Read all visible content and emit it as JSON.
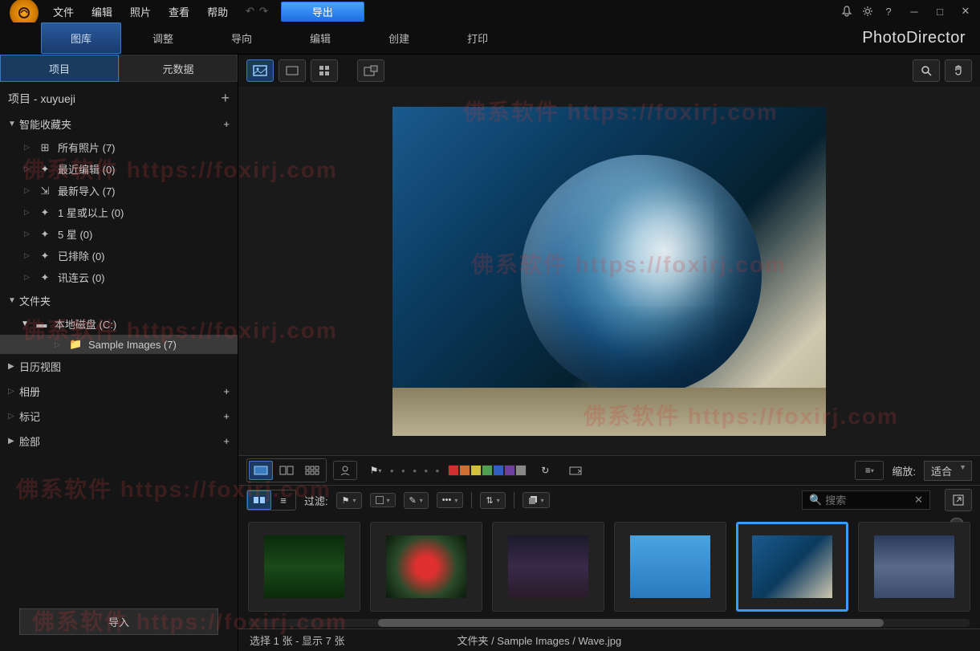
{
  "menu": {
    "file": "文件",
    "edit": "编辑",
    "photo": "照片",
    "view": "查看",
    "help": "帮助",
    "export": "导出"
  },
  "brand": "PhotoDirector",
  "tabs": {
    "library": "图库",
    "adjust": "调整",
    "guided": "导向",
    "edit": "编辑",
    "create": "创建",
    "print": "打印"
  },
  "sidebar": {
    "tabs": {
      "project": "项目",
      "metadata": "元数据"
    },
    "project_header": "项目 - xuyueji",
    "sections": {
      "smart": "智能收藏夹",
      "folders": "文件夹",
      "calendar": "日历视图",
      "albums": "相册",
      "tags": "标记",
      "faces": "脸部"
    },
    "smart_items": [
      {
        "label": "所有照片 (7)"
      },
      {
        "label": "最近编辑 (0)"
      },
      {
        "label": "最新导入 (7)"
      },
      {
        "label": "1 星或以上 (0)"
      },
      {
        "label": "5 星 (0)"
      },
      {
        "label": "已排除 (0)"
      },
      {
        "label": "讯连云 (0)"
      }
    ],
    "disk": "本地磁盘 (C:)",
    "folder": "Sample Images (7)",
    "import": "导入"
  },
  "midbar": {
    "zoom_label": "缩放:",
    "zoom_value": "适合"
  },
  "filterbar": {
    "filter_label": "过滤:",
    "search_placeholder": "搜索"
  },
  "status": {
    "selection": "选择 1 张 - 显示 7 张",
    "path": "文件夹 / Sample Images / Wave.jpg"
  },
  "colors": [
    "#d03030",
    "#d07030",
    "#d0c040",
    "#50a050",
    "#3060c0",
    "#7040a0",
    "#888888"
  ],
  "watermarks": [
    "佛系软件 https://foxirj.com",
    "佛系软件 https://foxirj.com",
    "佛系软件 https://foxirj.com",
    "佛系软件 https://foxirj.com",
    "佛系软件 https://foxirj.com",
    "佛系软件 https://foxirj.com"
  ]
}
